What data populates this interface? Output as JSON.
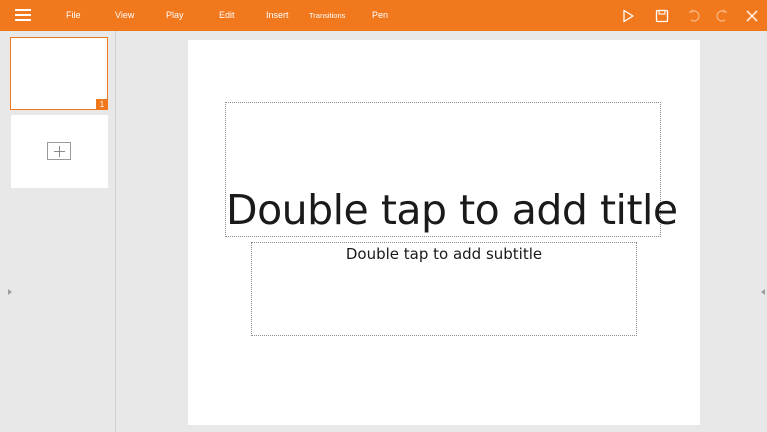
{
  "toolbar": {
    "menu": [
      "File",
      "View",
      "Play",
      "Edit",
      "Insert",
      "Transitions",
      "Pen"
    ],
    "icons": [
      "hamburger-menu-icon",
      "play-icon",
      "save-icon",
      "undo-icon",
      "redo-icon",
      "close-icon"
    ],
    "accent_color": "#f2781d"
  },
  "slides": {
    "thumbnails": [
      {
        "number": "1",
        "selected": true
      }
    ],
    "add_slide_icon": "plus-icon"
  },
  "slide": {
    "title_placeholder": "Double tap to add title",
    "subtitle_placeholder": "Double tap to add subtitle"
  }
}
